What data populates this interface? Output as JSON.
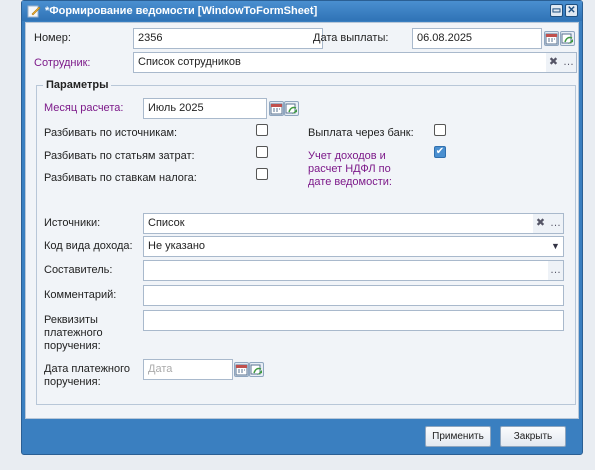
{
  "window": {
    "title": "*Формирование ведомости [WindowToFormSheet]",
    "minimize_icon": "restore-icon",
    "close_icon": "close-icon"
  },
  "top": {
    "number_label": "Номер:",
    "number_value": "2356",
    "payment_date_label": "Дата выплаты:",
    "payment_date_value": "06.08.2025",
    "employee_label": "Сотрудник:",
    "employee_value": "Список сотрудников"
  },
  "params": {
    "legend": "Параметры",
    "calc_month_label": "Месяц расчета:",
    "calc_month_value": "Июль 2025",
    "split_sources_label": "Разбивать по источникам:",
    "split_sources_checked": false,
    "split_costs_label": "Разбивать по статьям затрат:",
    "split_costs_checked": false,
    "split_tax_rates_label": "Разбивать по ставкам налога:",
    "split_tax_rates_checked": false,
    "bank_payment_label": "Выплата через банк:",
    "bank_payment_checked": false,
    "income_account_label_1": "Учет доходов и",
    "income_account_label_2": "расчет НДФЛ по",
    "income_account_label_3": "дате ведомости:",
    "income_account_checked": true,
    "sources_label": "Источники:",
    "sources_value": "Список",
    "income_code_label": "Код вида дохода:",
    "income_code_value": "Не указано",
    "author_label": "Составитель:",
    "author_value": "",
    "comment_label": "Комментарий:",
    "comment_value": "",
    "requisites_label_1": "Реквизиты",
    "requisites_label_2": "платежного",
    "requisites_label_3": "поручения:",
    "requisites_value": "",
    "order_date_label_1": "Дата платежного",
    "order_date_label_2": "поручения:",
    "order_date_placeholder": "Дата"
  },
  "footer": {
    "apply_label": "Применить",
    "close_label": "Закрыть"
  },
  "colors": {
    "accent": "#3a7fc0",
    "required_label": "#7d1a8a"
  }
}
